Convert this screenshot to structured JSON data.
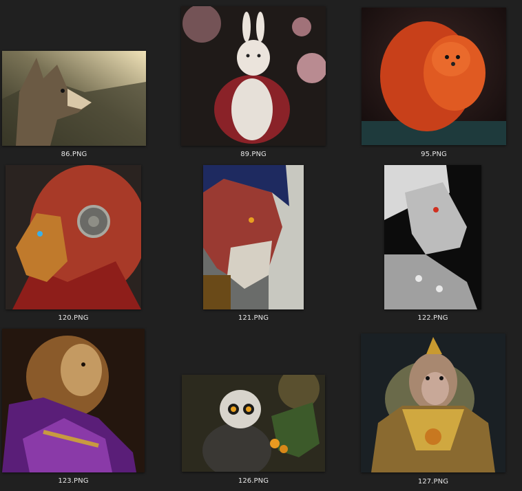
{
  "files": [
    {
      "name": "86.PNG",
      "subject": "wolf",
      "icon": "wolf-thumbnail"
    },
    {
      "name": "89.PNG",
      "subject": "rabbit in kimono",
      "icon": "rabbit-thumbnail"
    },
    {
      "name": "95.PNG",
      "subject": "orange pomeranian",
      "icon": "dog-thumbnail"
    },
    {
      "name": "120.PNG",
      "subject": "lion warrior",
      "icon": "lion-warrior-thumbnail"
    },
    {
      "name": "121.PNG",
      "subject": "red demon beast",
      "icon": "demon-thumbnail"
    },
    {
      "name": "122.PNG",
      "subject": "silver armored lion",
      "icon": "silver-lion-thumbnail"
    },
    {
      "name": "123.PNG",
      "subject": "lion in purple robe",
      "icon": "lion-robe-thumbnail"
    },
    {
      "name": "126.PNG",
      "subject": "lemur",
      "icon": "lemur-thumbnail"
    },
    {
      "name": "127.PNG",
      "subject": "monkey king",
      "icon": "monkey-thumbnail"
    }
  ],
  "colors": {
    "background": "#202020",
    "caption": "#e8e8e8"
  }
}
